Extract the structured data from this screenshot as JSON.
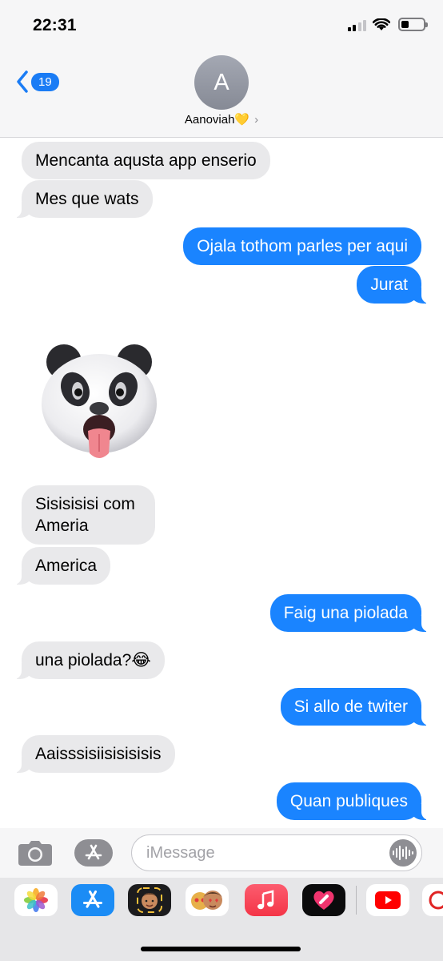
{
  "status_bar": {
    "time": "22:31"
  },
  "nav": {
    "back_badge": "19",
    "avatar_initial": "A",
    "contact_name": "Aanoviah💛",
    "chevron": "›"
  },
  "messages": [
    {
      "id": "m1",
      "direction": "incoming",
      "text": "Mencanta aqusta app enserio"
    },
    {
      "id": "m2",
      "direction": "incoming",
      "text": "Mes que wats"
    },
    {
      "id": "m3",
      "direction": "outgoing",
      "text": "Ojala tothom parles per aqui"
    },
    {
      "id": "m4",
      "direction": "outgoing",
      "text": "Jurat"
    },
    {
      "id": "m5",
      "direction": "incoming",
      "type": "animoji",
      "icon": "panda-animoji-icon"
    },
    {
      "id": "m6",
      "direction": "incoming",
      "text": "Sisisisisi com Ameria"
    },
    {
      "id": "m7",
      "direction": "incoming",
      "text": "America"
    },
    {
      "id": "m8",
      "direction": "outgoing",
      "text": "Faig una piolada"
    },
    {
      "id": "m9",
      "direction": "incoming",
      "text": "una piolada?😂"
    },
    {
      "id": "m10",
      "direction": "outgoing",
      "text": "Si allo de twiter"
    },
    {
      "id": "m11",
      "direction": "incoming",
      "text": "Aaisssisiisisisisis"
    },
    {
      "id": "m12",
      "direction": "outgoing",
      "text": "Quan publiques"
    }
  ],
  "input_bar": {
    "placeholder": "iMessage"
  },
  "app_drawer": {
    "apps": [
      "photos-icon",
      "app-store-icon",
      "memoji-icon",
      "memoji-stickers-icon",
      "music-icon",
      "digital-touch-icon",
      "youtube-icon",
      "partial-app-icon"
    ]
  },
  "colors": {
    "outgoing_bubble": "#1a84ff",
    "incoming_bubble": "#e9e9eb",
    "accent": "#1a7cf5"
  }
}
